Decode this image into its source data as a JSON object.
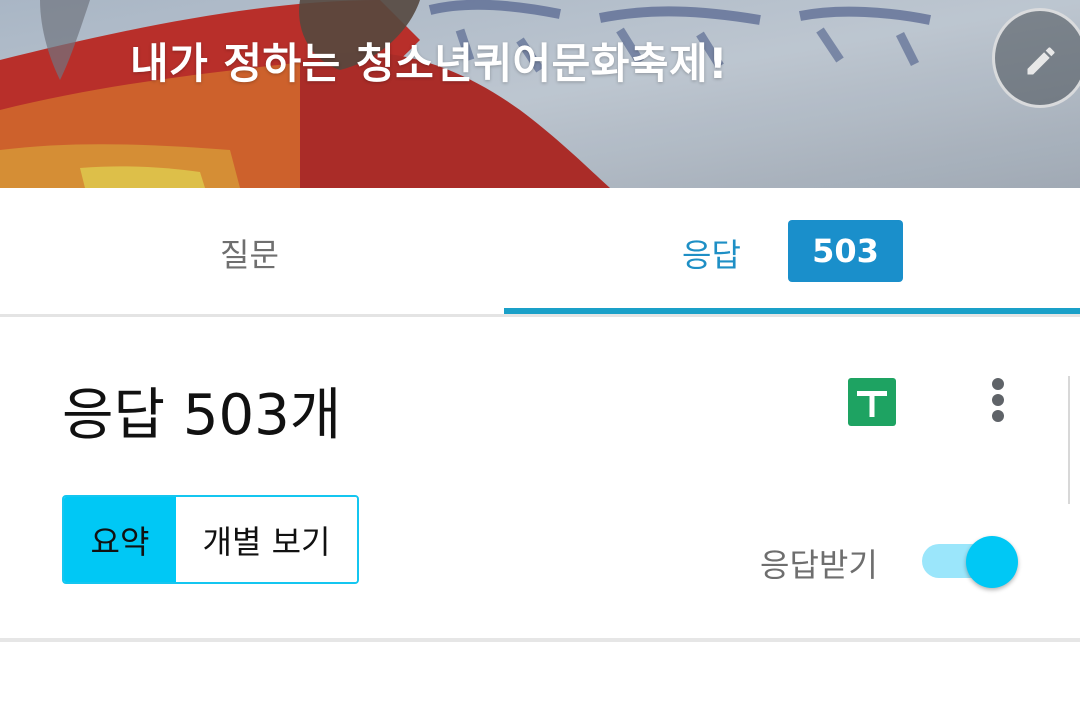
{
  "header": {
    "title": "내가 정하는 청소년퀴어문화축제!",
    "edit_icon": "pencil-icon"
  },
  "tabs": [
    {
      "label": "질문",
      "active": false
    },
    {
      "label": "응답",
      "active": true,
      "badge": "503"
    }
  ],
  "responses": {
    "heading": "응답 503개",
    "sheets_icon": "google-sheets-icon",
    "more_icon": "more-vert-icon",
    "view_toggle": {
      "summary_label": "요약",
      "individual_label": "개별 보기",
      "selected": "요약"
    },
    "accepting_label": "응답받기",
    "accepting": true
  },
  "colors": {
    "accent": "#1a8fcb",
    "tab_indicator": "#1aa0c8",
    "toggle_active": "#00c8f5",
    "sheets_green": "#1ea362"
  }
}
